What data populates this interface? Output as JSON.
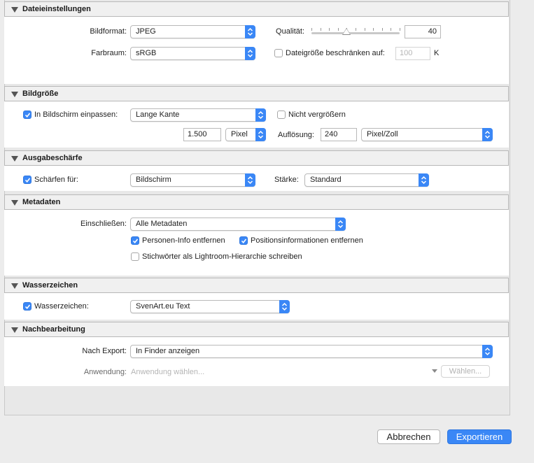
{
  "colors": {
    "accent": "#3a87f6",
    "section_header_bg": "#f0f0f0",
    "body_bg": "#ffffff"
  },
  "dateieinstellungen": {
    "title": "Dateieinstellungen",
    "bildformat_label": "Bildformat:",
    "bildformat_value": "JPEG",
    "farbraum_label": "Farbraum:",
    "farbraum_value": "sRGB",
    "qualitaet_label": "Qualität:",
    "qualitaet_value": "40",
    "qualitaet_level": 0.4,
    "limit_label": "Dateigröße beschränken auf:",
    "limit_checked": false,
    "limit_value": "100",
    "limit_unit": "K"
  },
  "bildgroesse": {
    "title": "Bildgröße",
    "fit_label": "In Bildschirm einpassen:",
    "fit_checked": true,
    "fit_value": "Lange Kante",
    "no_enlarge_label": "Nicht vergrößern",
    "no_enlarge_checked": false,
    "size_value": "1.500",
    "size_unit": "Pixel",
    "resolution_label": "Auflösung:",
    "resolution_value": "240",
    "resolution_unit": "Pixel/Zoll"
  },
  "ausgabeschaerfe": {
    "title": "Ausgabeschärfe",
    "sharpen_label": "Schärfen für:",
    "sharpen_checked": true,
    "sharpen_value": "Bildschirm",
    "strength_label": "Stärke:",
    "strength_value": "Standard"
  },
  "metadaten": {
    "title": "Metadaten",
    "include_label": "Einschließen:",
    "include_value": "Alle Metadaten",
    "person_info_label": "Personen-Info entfernen",
    "person_info_checked": true,
    "location_label": "Positionsinformationen entfernen",
    "location_checked": true,
    "keywords_label": "Stichwörter als Lightroom-Hierarchie schreiben",
    "keywords_checked": false
  },
  "wasserzeichen": {
    "title": "Wasserzeichen",
    "watermark_label": "Wasserzeichen:",
    "watermark_checked": true,
    "watermark_value": "SvenArt.eu Text"
  },
  "nachbearbeitung": {
    "title": "Nachbearbeitung",
    "after_export_label": "Nach Export:",
    "after_export_value": "In Finder anzeigen",
    "application_label": "Anwendung:",
    "application_placeholder": "Anwendung wählen...",
    "choose_button": "Wählen..."
  },
  "footer": {
    "cancel_button": "Abbrechen",
    "export_button": "Exportieren"
  }
}
